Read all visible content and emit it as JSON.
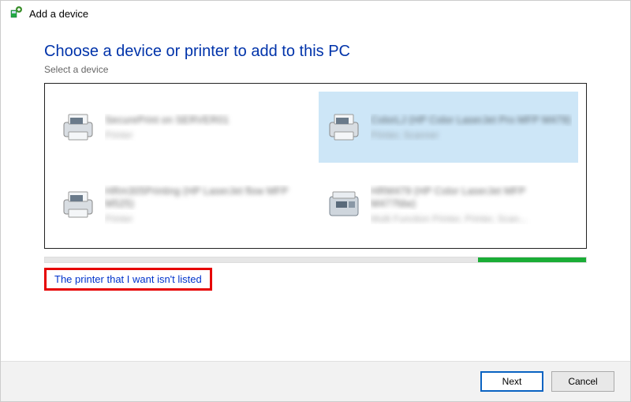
{
  "title": "Add a device",
  "heading": "Choose a device or printer to add to this PC",
  "subheading": "Select a device",
  "devices": [
    {
      "name": "SecurePrint on SERVER01",
      "type": "Printer",
      "selected": false
    },
    {
      "name": "ColorLJ (HP Color LaserJet Pro MFP M479)",
      "type": "Printer, Scanner",
      "selected": true
    },
    {
      "name": "HRm305Printing (HP LaserJet flow MFP M525)",
      "type": "Printer",
      "selected": false
    },
    {
      "name": "HRM479 (HP Color LaserJet MFP M477fdw)",
      "type": "Multi Function Printer, Printer, Scan...",
      "selected": false
    }
  ],
  "progress_pct": 80,
  "not_listed_link": "The printer that I want isn't listed",
  "buttons": {
    "next": "Next",
    "cancel": "Cancel"
  }
}
